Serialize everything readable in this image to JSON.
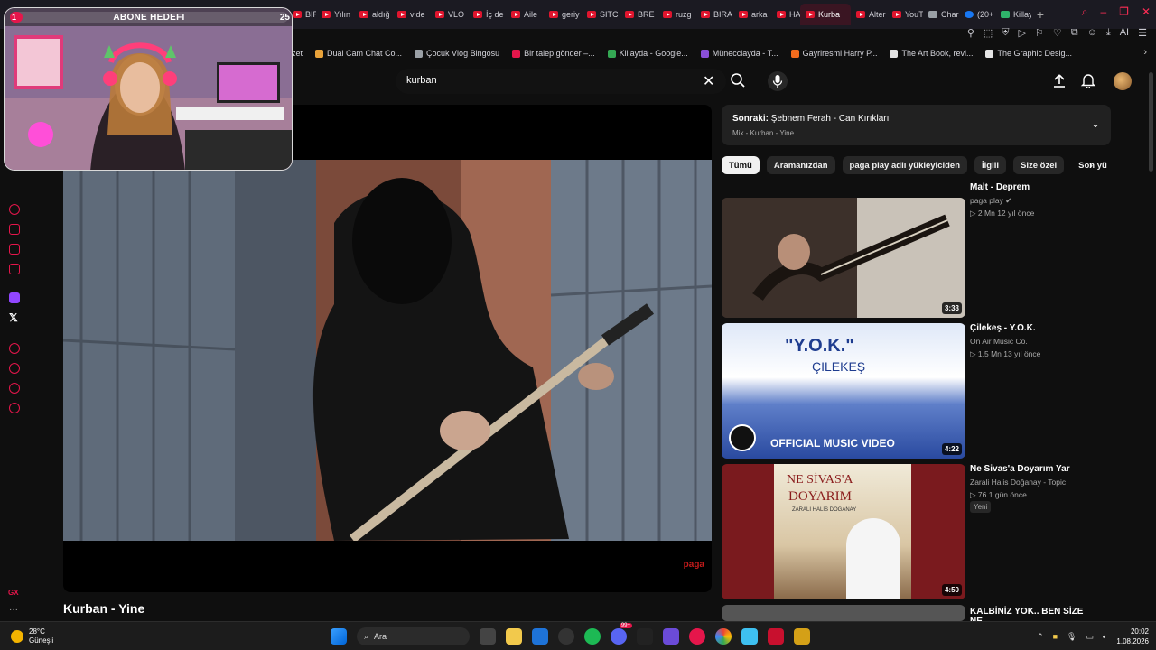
{
  "browser": {
    "tabs": [
      {
        "label": "BIRA",
        "icon": "youtube-icon"
      },
      {
        "label": "Yılın",
        "icon": "youtube-icon"
      },
      {
        "label": "aldığ",
        "icon": "youtube-icon"
      },
      {
        "label": "vide",
        "icon": "youtube-icon"
      },
      {
        "label": "VLO",
        "icon": "youtube-icon"
      },
      {
        "label": "İç de",
        "icon": "youtube-icon"
      },
      {
        "label": "Aile",
        "icon": "youtube-icon"
      },
      {
        "label": "geriy",
        "icon": "youtube-icon"
      },
      {
        "label": "SITC",
        "icon": "youtube-icon"
      },
      {
        "label": "BRE",
        "icon": "youtube-icon"
      },
      {
        "label": "ruzg",
        "icon": "youtube-icon"
      },
      {
        "label": "BIRA",
        "icon": "youtube-icon"
      },
      {
        "label": "arka",
        "icon": "youtube-icon"
      },
      {
        "label": "HAN",
        "icon": "youtube-icon"
      },
      {
        "label": "Kurba",
        "icon": "youtube-icon",
        "active": true
      },
      {
        "label": "Alter",
        "icon": "youtube-icon"
      },
      {
        "label": "YouT",
        "icon": "youtube-icon"
      },
      {
        "label": "Char",
        "icon": "google-icon"
      },
      {
        "label": "(20+",
        "icon": "facebook-icon"
      },
      {
        "label": "Killay",
        "icon": "tt-icon"
      }
    ],
    "new_tab": "+",
    "toolbar_ai": "AI",
    "bookmarks": [
      {
        "label": "ozet"
      },
      {
        "label": "Dual Cam Chat Co..."
      },
      {
        "label": "Çocuk Vlog Bingosu"
      },
      {
        "label": "Bir talep gönder –..."
      },
      {
        "label": "Killayda - Google..."
      },
      {
        "label": "Münecciayda - T..."
      },
      {
        "label": "Gayriresmi Harry P..."
      },
      {
        "label": "The Art Book, revi..."
      },
      {
        "label": "The Graphic Desig..."
      }
    ]
  },
  "webcam": {
    "goal_label": "ABONE HEDEFI",
    "goal_current": "1",
    "goal_target": "25",
    "goal_progress": 0.04
  },
  "youtube": {
    "search_value": "kurban",
    "video_title": "Kurban - Yine",
    "watermark": "paga",
    "up_next": {
      "prefix": "Sonraki:",
      "title": "Şebnem Ferah - Can Kırıkları",
      "subtitle": "Mix - Kurban - Yine"
    },
    "chips": [
      {
        "label": "Tümü",
        "active": true
      },
      {
        "label": "Aramanızdan"
      },
      {
        "label": "paga play adlı yükleyiciden"
      },
      {
        "label": "İlgili"
      },
      {
        "label": "Size özel"
      },
      {
        "label": "Son yükl"
      }
    ],
    "recommendations": [
      {
        "title": "Malt - Deprem",
        "channel": "paga play",
        "verified": true,
        "views": "2 Mn",
        "age": "12 yıl önce",
        "duration": "3:33"
      },
      {
        "title": "Çilekeş - Y.O.K.",
        "channel": "On Air Music Co.",
        "views": "1,5 Mn",
        "age": "13 yıl önce",
        "duration": "4:22",
        "thumb_text_1": "\"Y.O.K.\"",
        "thumb_text_2": "ÇILEKEŞ",
        "thumb_text_3": "OFFICIAL MUSIC VIDEO"
      },
      {
        "title": "Ne Sivas'a Doyarım Yar",
        "channel": "Zarali Halis Doğanay - Topic",
        "views": "76",
        "age": "1 gün önce",
        "badge": "Yeni",
        "duration": "4:50",
        "thumb_text_1": "NE SİVAS'A",
        "thumb_text_2": "DOYARIM",
        "thumb_text_3": "ZARALI HALİS DOĞANAY"
      },
      {
        "title": "KALBİNİZ YOK.. BEN SİZE NE"
      }
    ]
  },
  "taskbar": {
    "weather_temp": "28°C",
    "weather_desc": "Güneşli",
    "search_label": "Ara",
    "time": "20:02",
    "date": "1.08.2026",
    "notif_badge": "99+"
  }
}
